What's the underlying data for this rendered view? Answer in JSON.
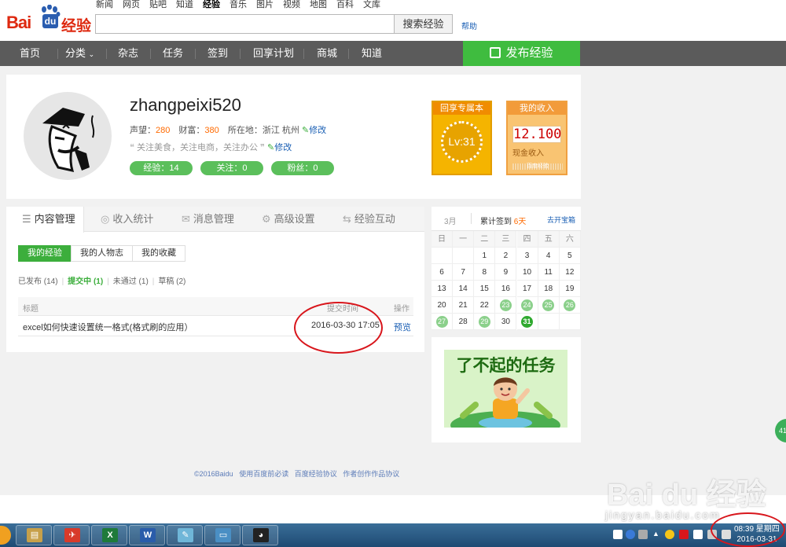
{
  "header": {
    "logo": {
      "bai": "Bai",
      "du": "du",
      "jy": "经验"
    },
    "topnav": [
      "新闻",
      "网页",
      "贴吧",
      "知道",
      "经验",
      "音乐",
      "图片",
      "视频",
      "地图",
      "百科",
      "文库"
    ],
    "search_value": "",
    "search_button": "搜索经验",
    "help": "帮助"
  },
  "mainnav": {
    "items": [
      "首页",
      "分类",
      "杂志",
      "任务",
      "签到",
      "回享计划",
      "商城",
      "知道"
    ],
    "publish": "发布经验"
  },
  "profile": {
    "username": "zhangpeixi520",
    "reputation_label": "声望：",
    "reputation": "280",
    "wealth_label": "财富：",
    "wealth": "380",
    "location_label": "所在地：",
    "location": "浙江 杭州",
    "edit": "修改",
    "bio": "关注美食，关注电商，关注办公",
    "bio_quote_close": "",
    "pills": [
      "经验：14",
      "关注：0",
      "粉丝：0"
    ],
    "level_badge": {
      "title": "回享专属本",
      "level": "Lv:31"
    },
    "income_badge": {
      "title": "我的收入",
      "amount": "12.100",
      "cash_label": "现金收入",
      "footer": "百度经验"
    }
  },
  "content": {
    "tabs": [
      "内容管理",
      "收入统计",
      "消息管理",
      "高级设置",
      "经验互动"
    ],
    "subtabs": [
      "我的经验",
      "我的人物志",
      "我的收藏"
    ],
    "filters": [
      "已发布 (14)",
      "提交中 (1)",
      "未通过 (1)",
      "草稿 (2)"
    ],
    "table": {
      "headers": [
        "标题",
        "提交时间",
        "操作"
      ],
      "rows": [
        {
          "title": "excel如何快速设置统一格式(格式刷的应用）",
          "time": "2016-03-30 17:05",
          "action": "预览"
        }
      ]
    }
  },
  "calendar": {
    "month": "3月",
    "streak_label": "累计签到",
    "streak": "6天",
    "open_box": "去开宝箱",
    "weekdays": [
      "日",
      "一",
      "二",
      "三",
      "四",
      "五",
      "六"
    ],
    "days": [
      "",
      "",
      "1",
      "2",
      "3",
      "4",
      "5",
      "6",
      "7",
      "8",
      "9",
      "10",
      "11",
      "12",
      "13",
      "14",
      "15",
      "16",
      "17",
      "18",
      "19",
      "20",
      "21",
      "22",
      "23",
      "24",
      "25",
      "26",
      "27",
      "28",
      "29",
      "30",
      "31",
      "",
      ""
    ],
    "signed": [
      "23",
      "24",
      "25",
      "26",
      "27",
      "29"
    ],
    "today": "31"
  },
  "promo": {
    "title": "了不起的任务"
  },
  "footer": [
    "©2016Baidu",
    "使用百度前必读",
    "百度经验协议",
    "作者创作作品协议"
  ],
  "watermark": {
    "main": "Bai du 经验",
    "sub": "jingyan.baidu.com"
  },
  "taskbar": {
    "apps": [
      "explorer-icon",
      "media-icon",
      "flashget-icon",
      "excel-icon",
      "word-icon",
      "notepad-icon",
      "window-icon",
      "qq-icon"
    ],
    "time": "08:39 星期四",
    "date": "2016-03-31"
  },
  "side_button": "41"
}
